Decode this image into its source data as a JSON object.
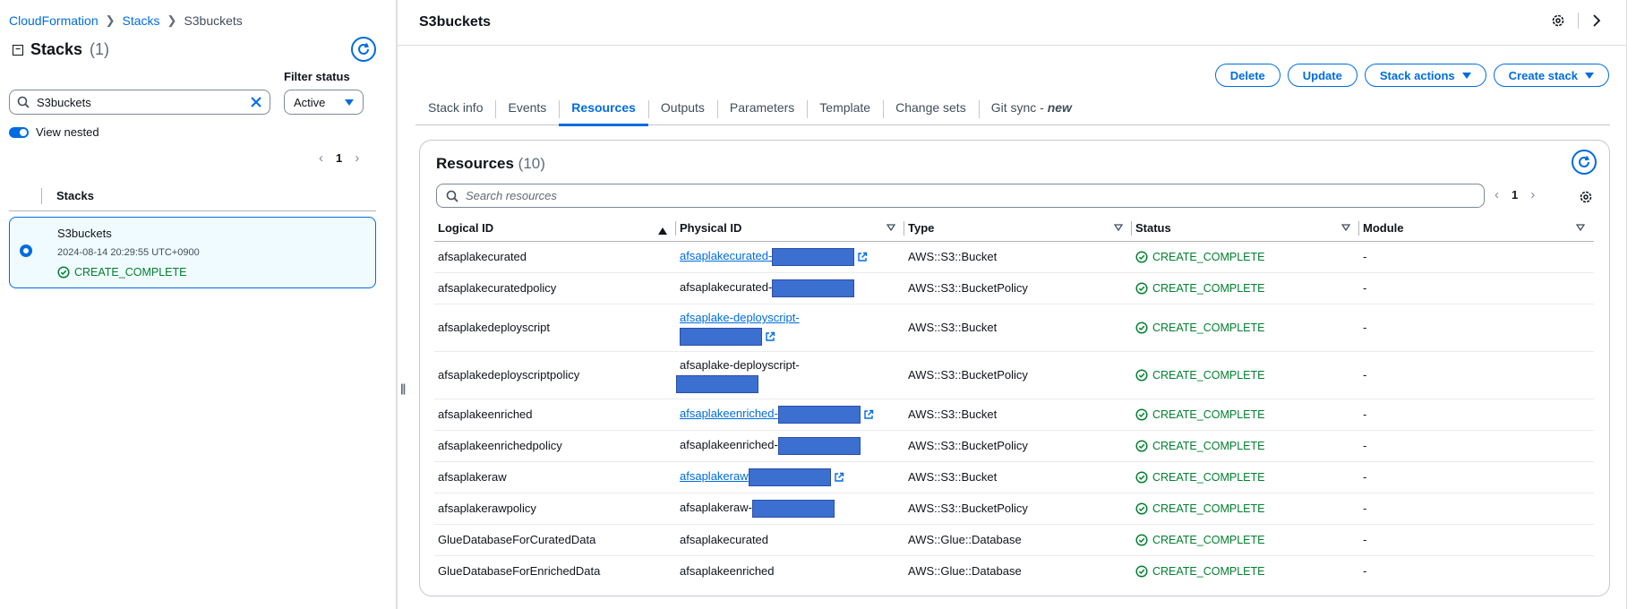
{
  "breadcrumb": {
    "root": "CloudFormation",
    "stacks": "Stacks",
    "current": "S3buckets"
  },
  "sidebar": {
    "title": "Stacks",
    "count": "(1)",
    "filter_label": "Filter status",
    "search_value": "S3buckets",
    "filter_value": "Active",
    "view_nested_label": "View nested",
    "page": "1",
    "column_header": "Stacks",
    "stack": {
      "name": "S3buckets",
      "created": "2024-08-14 20:29:55 UTC+0900",
      "status": "CREATE_COMPLETE"
    }
  },
  "main": {
    "title": "S3buckets",
    "buttons": {
      "delete": "Delete",
      "update": "Update",
      "stack_actions": "Stack actions",
      "create_stack": "Create stack"
    },
    "tabs": [
      {
        "label": "Stack info"
      },
      {
        "label": "Events"
      },
      {
        "label": "Resources"
      },
      {
        "label": "Outputs"
      },
      {
        "label": "Parameters"
      },
      {
        "label": "Template"
      },
      {
        "label": "Change sets"
      },
      {
        "label": "Git sync - ",
        "badge": "new"
      }
    ],
    "active_tab": "Resources",
    "resources": {
      "title": "Resources",
      "count": "(10)",
      "search_placeholder": "Search resources",
      "page": "1",
      "columns": [
        "Logical ID",
        "Physical ID",
        "Type",
        "Status",
        "Module"
      ],
      "rows": [
        {
          "logical_id": "afsaplakecurated",
          "physical_id": "afsaplakecurated-",
          "type": "AWS::S3::Bucket",
          "status": "CREATE_COMPLETE",
          "module": "-"
        },
        {
          "logical_id": "afsaplakecuratedpolicy",
          "physical_id": "afsaplakecurated-",
          "type": "AWS::S3::BucketPolicy",
          "status": "CREATE_COMPLETE",
          "module": "-"
        },
        {
          "logical_id": "afsaplakedeployscript",
          "physical_id": "afsaplake-deployscript-",
          "type": "AWS::S3::Bucket",
          "status": "CREATE_COMPLETE",
          "module": "-"
        },
        {
          "logical_id": "afsaplakedeployscriptpolicy",
          "physical_id": "afsaplake-deployscript-",
          "type": "AWS::S3::BucketPolicy",
          "status": "CREATE_COMPLETE",
          "module": "-"
        },
        {
          "logical_id": "afsaplakeenriched",
          "physical_id": "afsaplakeenriched-",
          "type": "AWS::S3::Bucket",
          "status": "CREATE_COMPLETE",
          "module": "-"
        },
        {
          "logical_id": "afsaplakeenrichedpolicy",
          "physical_id": "afsaplakeenriched-",
          "type": "AWS::S3::BucketPolicy",
          "status": "CREATE_COMPLETE",
          "module": "-"
        },
        {
          "logical_id": "afsaplakeraw",
          "physical_id": "afsaplakeraw",
          "type": "AWS::S3::Bucket",
          "status": "CREATE_COMPLETE",
          "module": "-"
        },
        {
          "logical_id": "afsaplakerawpolicy",
          "physical_id": "afsaplakeraw-",
          "type": "AWS::S3::BucketPolicy",
          "status": "CREATE_COMPLETE",
          "module": "-"
        },
        {
          "logical_id": "GlueDatabaseForCuratedData",
          "physical_id": "afsaplakecurated",
          "type": "AWS::Glue::Database",
          "status": "CREATE_COMPLETE",
          "module": "-"
        },
        {
          "logical_id": "GlueDatabaseForEnrichedData",
          "physical_id": "afsaplakeenriched",
          "type": "AWS::Glue::Database",
          "status": "CREATE_COMPLETE",
          "module": "-"
        }
      ]
    }
  },
  "colors": {
    "accent": "#006ce0",
    "success": "#00802f",
    "redaction": "#3b6fd0"
  }
}
